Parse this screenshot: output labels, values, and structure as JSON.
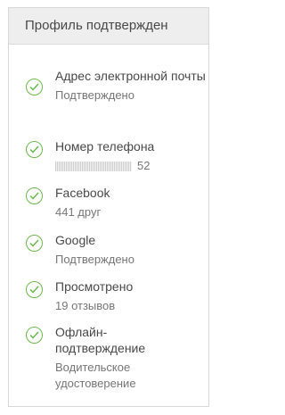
{
  "header": {
    "title": "Профиль подтвержден"
  },
  "items": [
    {
      "title": "Адрес электронной почты",
      "subtitle": "Подтверждено"
    },
    {
      "title": "Номер телефона",
      "subtitle_suffix": "52"
    },
    {
      "title": "Facebook",
      "subtitle": "441 друг"
    },
    {
      "title": "Google",
      "subtitle": "Подтверждено"
    },
    {
      "title": "Просмотрено",
      "subtitle": "19 отзывов"
    },
    {
      "title": "Офлайн-подтверждение",
      "subtitle": "Водительское удостоверение"
    }
  ],
  "colors": {
    "check": "#6bb94e",
    "header_bg": "#eeeeee",
    "text": "#484848",
    "muted": "#767676"
  }
}
